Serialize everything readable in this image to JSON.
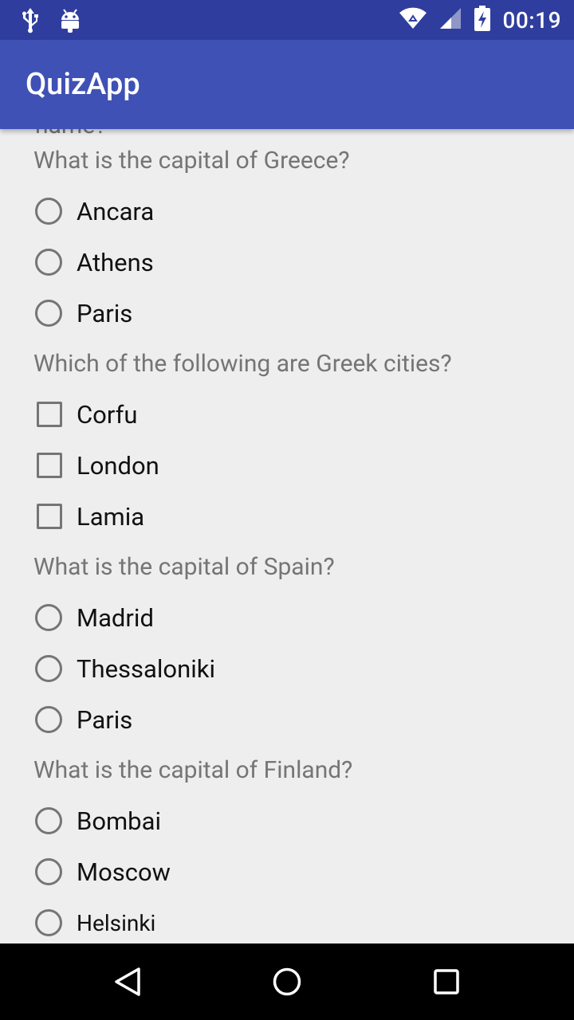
{
  "status_bar": {
    "time": "00:19",
    "icons": [
      "usb-icon",
      "android-debug-icon",
      "wifi-icon",
      "signal-icon",
      "battery-charging-icon"
    ]
  },
  "app_bar": {
    "title": "QuizApp"
  },
  "clipped_text": "name?",
  "questions": [
    {
      "text": "What is the capital of Greece?",
      "type": "radio",
      "options": [
        "Ancara",
        "Athens",
        "Paris"
      ]
    },
    {
      "text": "Which of the following are Greek cities?",
      "type": "checkbox",
      "options": [
        "Corfu",
        "London",
        "Lamia"
      ]
    },
    {
      "text": "What is the capital of Spain?",
      "type": "radio",
      "options": [
        "Madrid",
        "Thessaloniki",
        "Paris"
      ]
    },
    {
      "text": "What is the capital of Finland?",
      "type": "radio",
      "options": [
        "Bombai",
        "Moscow",
        "Helsinki"
      ]
    }
  ],
  "nav_bar": {
    "icons": [
      "back-icon",
      "home-icon",
      "recents-icon"
    ]
  },
  "colors": {
    "status_bar": "#2f3e9e",
    "app_bar": "#3f51b5",
    "background": "#eeeeee",
    "control": "#757575"
  }
}
